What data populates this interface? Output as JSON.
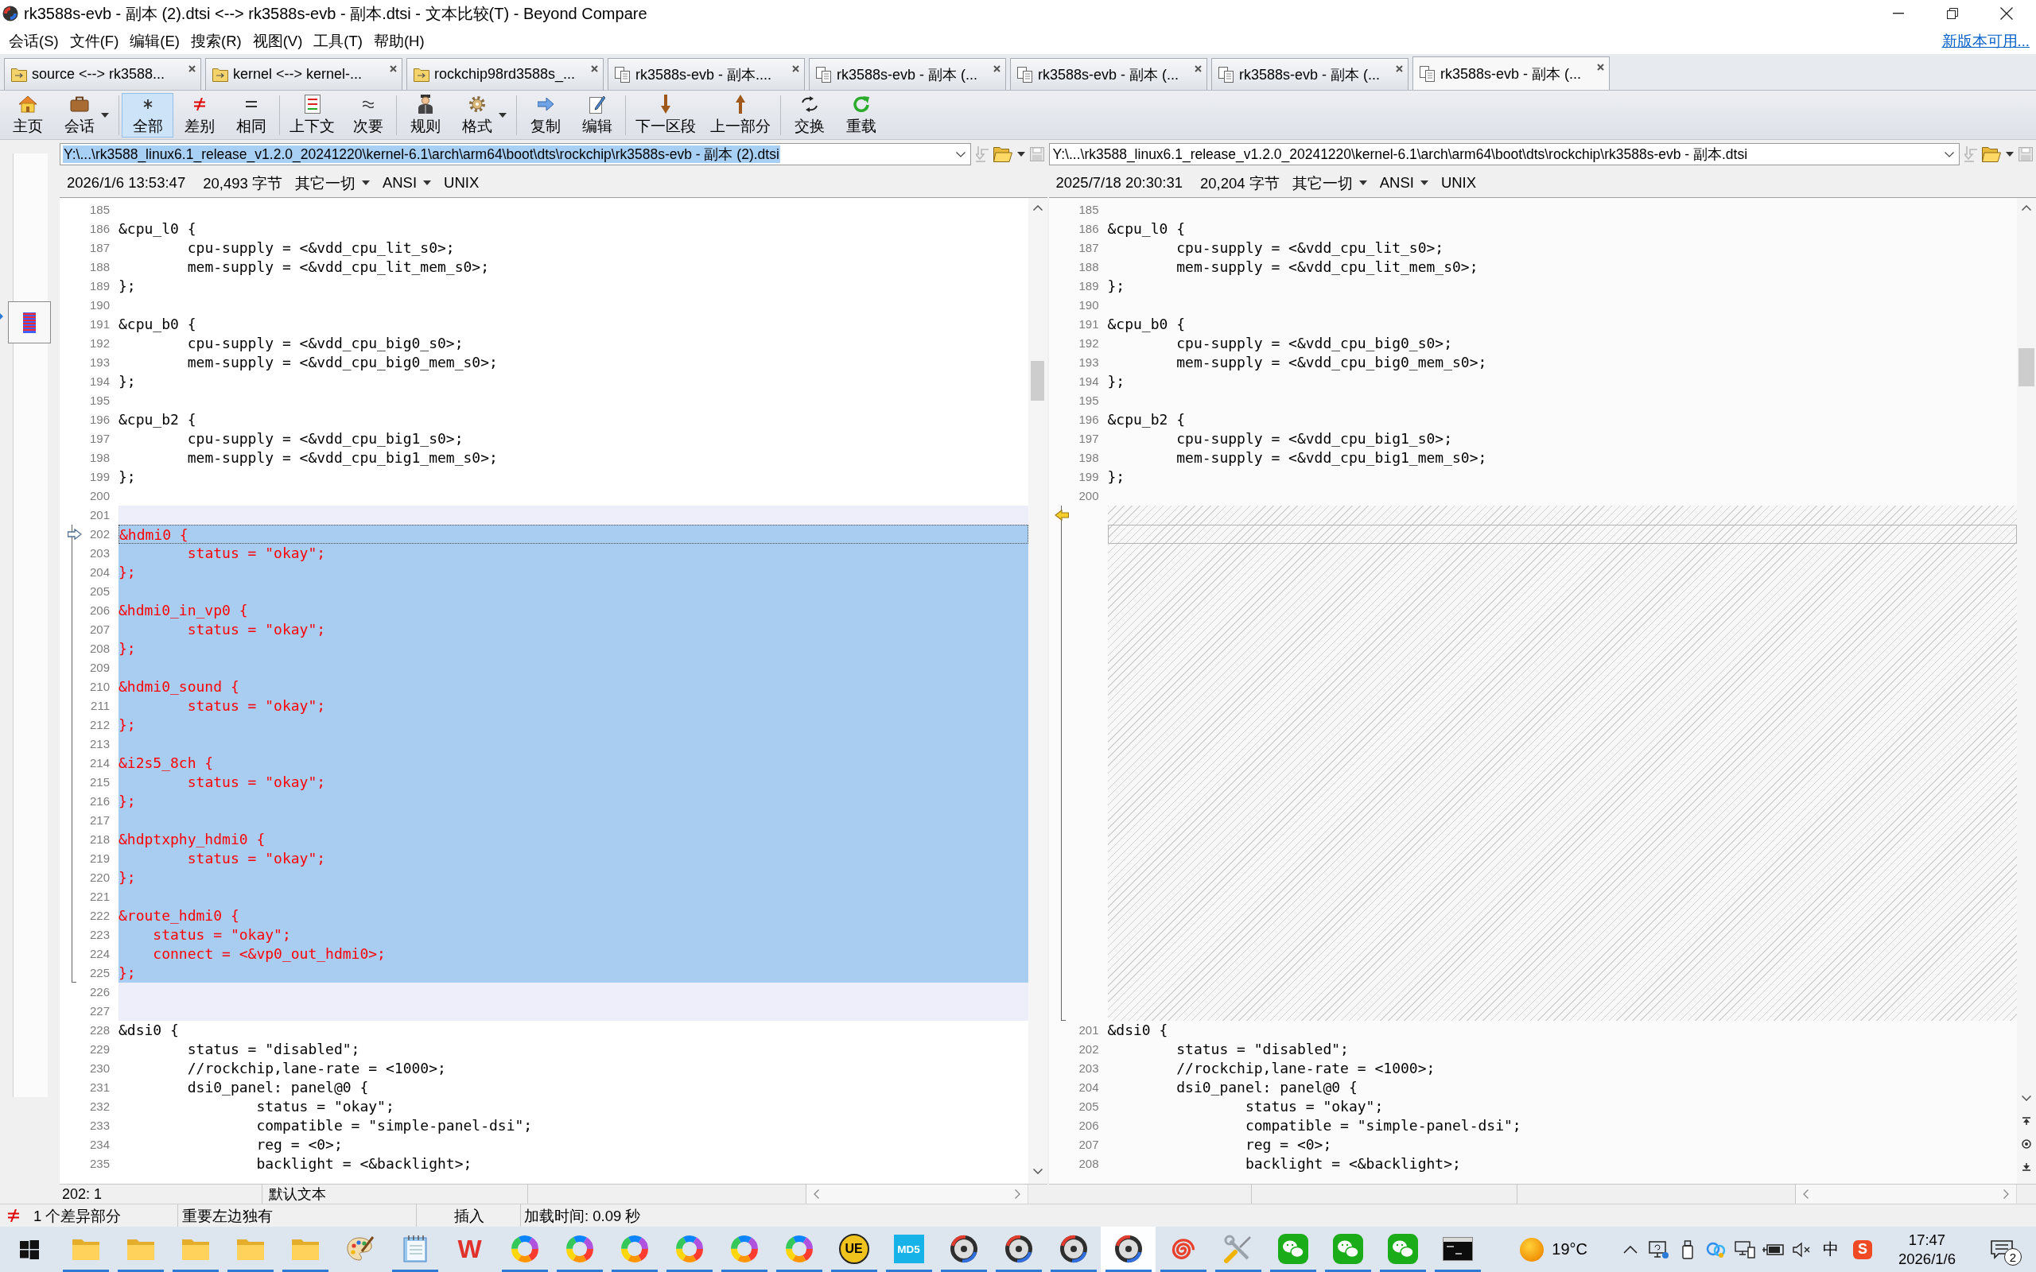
{
  "window": {
    "title": "rk3588s-evb - 副本 (2).dtsi <--> rk3588s-evb - 副本.dtsi - 文本比较(T) - Beyond Compare"
  },
  "menu": [
    "会话(S)",
    "文件(F)",
    "编辑(E)",
    "搜索(R)",
    "视图(V)",
    "工具(T)",
    "帮助(H)"
  ],
  "update_link": "新版本可用...",
  "tabs": [
    {
      "label": "source <--> rk3588...",
      "kind": "folder",
      "selected": false
    },
    {
      "label": "kernel <--> kernel-...",
      "kind": "folder",
      "selected": false
    },
    {
      "label": "rockchip98rd3588s_...",
      "kind": "folder",
      "selected": false
    },
    {
      "label": "rk3588s-evb - 副本....",
      "kind": "text",
      "selected": false
    },
    {
      "label": "rk3588s-evb - 副本 (...",
      "kind": "text",
      "selected": false
    },
    {
      "label": "rk3588s-evb - 副本 (...",
      "kind": "text",
      "selected": false
    },
    {
      "label": "rk3588s-evb - 副本 (...",
      "kind": "text",
      "selected": false
    },
    {
      "label": "rk3588s-evb - 副本 (...",
      "kind": "text",
      "selected": true
    }
  ],
  "toolbar": [
    [
      {
        "label": "主页",
        "kind": "home",
        "selected": false,
        "dropdown": false
      },
      {
        "label": "会话",
        "kind": "session",
        "selected": false,
        "dropdown": true
      }
    ],
    [
      {
        "label": "全部",
        "kind": "all",
        "selected": true,
        "dropdown": false
      },
      {
        "label": "差别",
        "kind": "diffs",
        "selected": false,
        "dropdown": false
      },
      {
        "label": "相同",
        "kind": "same",
        "selected": false,
        "dropdown": false
      }
    ],
    [
      {
        "label": "上下文",
        "kind": "context",
        "selected": false,
        "dropdown": false
      },
      {
        "label": "次要",
        "kind": "minor",
        "selected": false,
        "dropdown": false
      }
    ],
    [
      {
        "label": "规则",
        "kind": "rules",
        "selected": false,
        "dropdown": false
      },
      {
        "label": "格式",
        "kind": "format",
        "selected": false,
        "dropdown": true
      }
    ],
    [
      {
        "label": "复制",
        "kind": "copy",
        "selected": false,
        "dropdown": false
      },
      {
        "label": "编辑",
        "kind": "edit",
        "selected": false,
        "dropdown": false
      }
    ],
    [
      {
        "label": "下一区段",
        "kind": "next",
        "selected": false,
        "dropdown": false
      },
      {
        "label": "上一部分",
        "kind": "prev",
        "selected": false,
        "dropdown": false
      }
    ],
    [
      {
        "label": "交换",
        "kind": "swap",
        "selected": false,
        "dropdown": false
      },
      {
        "label": "重载",
        "kind": "reload",
        "selected": false,
        "dropdown": false
      }
    ]
  ],
  "panes": [
    {
      "path": "Y:\\...\\rk3588_linux6.1_release_v1.2.0_20241220\\kernel-6.1\\arch\\arm64\\boot\\dts\\rockchip\\rk3588s-evb - 副本 (2).dtsi",
      "path_selected": true,
      "modified": "2026/1/6 13:53:47",
      "size": "20,493 字节",
      "format": "其它一切",
      "encoding": "ANSI",
      "line_ending": "UNIX",
      "position": "202: 1",
      "text_format": "默认文本",
      "lines": [
        {
          "number": "185",
          "kind": "same",
          "current": false,
          "arrow": false
        },
        {
          "number": "186",
          "text": "&cpu_l0 {",
          "kind": "same",
          "current": false,
          "arrow": false
        },
        {
          "number": "187",
          "text": "\tcpu-supply = <&vdd_cpu_lit_s0>;",
          "kind": "same",
          "current": false,
          "arrow": false
        },
        {
          "number": "188",
          "text": "\tmem-supply = <&vdd_cpu_lit_mem_s0>;",
          "kind": "same",
          "current": false,
          "arrow": false
        },
        {
          "number": "189",
          "text": "};",
          "kind": "same",
          "current": false,
          "arrow": false
        },
        {
          "number": "190",
          "kind": "same",
          "current": false,
          "arrow": false
        },
        {
          "number": "191",
          "text": "&cpu_b0 {",
          "kind": "same",
          "current": false,
          "arrow": false
        },
        {
          "number": "192",
          "text": "\tcpu-supply = <&vdd_cpu_big0_s0>;",
          "kind": "same",
          "current": false,
          "arrow": false
        },
        {
          "number": "193",
          "text": "\tmem-supply = <&vdd_cpu_big0_mem_s0>;",
          "kind": "same",
          "current": false,
          "arrow": false
        },
        {
          "number": "194",
          "text": "};",
          "kind": "same",
          "current": false,
          "arrow": false
        },
        {
          "number": "195",
          "kind": "same",
          "current": false,
          "arrow": false
        },
        {
          "number": "196",
          "text": "&cpu_b2 {",
          "kind": "same",
          "current": false,
          "arrow": false
        },
        {
          "number": "197",
          "text": "\tcpu-supply = <&vdd_cpu_big1_s0>;",
          "kind": "same",
          "current": false,
          "arrow": false
        },
        {
          "number": "198",
          "text": "\tmem-supply = <&vdd_cpu_big1_mem_s0>;",
          "kind": "same",
          "current": false,
          "arrow": false
        },
        {
          "number": "199",
          "text": "};",
          "kind": "same",
          "current": false,
          "arrow": false
        },
        {
          "number": "200",
          "kind": "same",
          "current": false,
          "arrow": false
        },
        {
          "number": "201",
          "kind": "minor",
          "current": false,
          "arrow": false
        },
        {
          "number": "202",
          "text": "&hdmi0 {",
          "kind": "unique",
          "current": true,
          "arrow": true
        },
        {
          "number": "203",
          "text": "\tstatus = \"okay\";",
          "kind": "unique",
          "current": false,
          "arrow": false
        },
        {
          "number": "204",
          "text": "};",
          "kind": "unique",
          "current": false,
          "arrow": false
        },
        {
          "number": "205",
          "kind": "unique",
          "current": false,
          "arrow": false
        },
        {
          "number": "206",
          "text": "&hdmi0_in_vp0 {",
          "kind": "unique",
          "current": false,
          "arrow": false
        },
        {
          "number": "207",
          "text": "\tstatus = \"okay\";",
          "kind": "unique",
          "current": false,
          "arrow": false
        },
        {
          "number": "208",
          "text": "};",
          "kind": "unique",
          "current": false,
          "arrow": false
        },
        {
          "number": "209",
          "kind": "unique",
          "current": false,
          "arrow": false
        },
        {
          "number": "210",
          "text": "&hdmi0_sound {",
          "kind": "unique",
          "current": false,
          "arrow": false
        },
        {
          "number": "211",
          "text": "\tstatus = \"okay\";",
          "kind": "unique",
          "current": false,
          "arrow": false
        },
        {
          "number": "212",
          "text": "};",
          "kind": "unique",
          "current": false,
          "arrow": false
        },
        {
          "number": "213",
          "kind": "unique",
          "current": false,
          "arrow": false
        },
        {
          "number": "214",
          "text": "&i2s5_8ch {",
          "kind": "unique",
          "current": false,
          "arrow": false
        },
        {
          "number": "215",
          "text": "\tstatus = \"okay\";",
          "kind": "unique",
          "current": false,
          "arrow": false
        },
        {
          "number": "216",
          "text": "};",
          "kind": "unique",
          "current": false,
          "arrow": false
        },
        {
          "number": "217",
          "kind": "unique",
          "current": false,
          "arrow": false
        },
        {
          "number": "218",
          "text": "&hdptxphy_hdmi0 {",
          "kind": "unique",
          "current": false,
          "arrow": false
        },
        {
          "number": "219",
          "text": "\tstatus = \"okay\";",
          "kind": "unique",
          "current": false,
          "arrow": false
        },
        {
          "number": "220",
          "text": "};",
          "kind": "unique",
          "current": false,
          "arrow": false
        },
        {
          "number": "221",
          "kind": "unique",
          "current": false,
          "arrow": false
        },
        {
          "number": "222",
          "text": "&route_hdmi0 {",
          "kind": "unique",
          "current": false,
          "arrow": false
        },
        {
          "number": "223",
          "text": "    status = \"okay\";",
          "kind": "unique",
          "current": false,
          "arrow": false
        },
        {
          "number": "224",
          "text": "    connect = <&vp0_out_hdmi0>;",
          "kind": "unique",
          "current": false,
          "arrow": false
        },
        {
          "number": "225",
          "text": "};",
          "kind": "unique",
          "current": false,
          "arrow": false
        },
        {
          "number": "226",
          "kind": "minor",
          "current": false,
          "arrow": false
        },
        {
          "number": "227",
          "kind": "minor",
          "current": false,
          "arrow": false
        },
        {
          "number": "228",
          "text": "&dsi0 {",
          "kind": "same",
          "current": false,
          "arrow": false
        },
        {
          "number": "229",
          "text": "\tstatus = \"disabled\";",
          "kind": "same",
          "current": false,
          "arrow": false
        },
        {
          "number": "230",
          "text": "\t//rockchip,lane-rate = <1000>;",
          "kind": "same",
          "current": false,
          "arrow": false
        },
        {
          "number": "231",
          "text": "\tdsi0_panel: panel@0 {",
          "kind": "same",
          "current": false,
          "arrow": false
        },
        {
          "number": "232",
          "text": "\t\tstatus = \"okay\";",
          "kind": "same",
          "current": false,
          "arrow": false
        },
        {
          "number": "233",
          "text": "\t\tcompatible = \"simple-panel-dsi\";",
          "kind": "same",
          "current": false,
          "arrow": false
        },
        {
          "number": "234",
          "text": "\t\treg = <0>;",
          "kind": "same",
          "current": false,
          "arrow": false
        },
        {
          "number": "235",
          "text": "\t\tbacklight = <&backlight>;",
          "kind": "same",
          "current": false,
          "arrow": false
        }
      ]
    },
    {
      "path": "Y:\\...\\rk3588_linux6.1_release_v1.2.0_20241220\\kernel-6.1\\arch\\arm64\\boot\\dts\\rockchip\\rk3588s-evb - 副本.dtsi",
      "path_selected": false,
      "modified": "2025/7/18 20:30:31",
      "size": "20,204 字节",
      "format": "其它一切",
      "encoding": "ANSI",
      "line_ending": "UNIX",
      "lines": [
        {
          "number": "185",
          "kind": "same",
          "current": false,
          "arrow": false
        },
        {
          "number": "186",
          "text": "&cpu_l0 {",
          "kind": "same",
          "current": false,
          "arrow": false
        },
        {
          "number": "187",
          "text": "\tcpu-supply = <&vdd_cpu_lit_s0>;",
          "kind": "same",
          "current": false,
          "arrow": false
        },
        {
          "number": "188",
          "text": "\tmem-supply = <&vdd_cpu_lit_mem_s0>;",
          "kind": "same",
          "current": false,
          "arrow": false
        },
        {
          "number": "189",
          "text": "};",
          "kind": "same",
          "current": false,
          "arrow": false
        },
        {
          "number": "190",
          "kind": "same",
          "current": false,
          "arrow": false
        },
        {
          "number": "191",
          "text": "&cpu_b0 {",
          "kind": "same",
          "current": false,
          "arrow": false
        },
        {
          "number": "192",
          "text": "\tcpu-supply = <&vdd_cpu_big0_s0>;",
          "kind": "same",
          "current": false,
          "arrow": false
        },
        {
          "number": "193",
          "text": "\tmem-supply = <&vdd_cpu_big0_mem_s0>;",
          "kind": "same",
          "current": false,
          "arrow": false
        },
        {
          "number": "194",
          "text": "};",
          "kind": "same",
          "current": false,
          "arrow": false
        },
        {
          "number": "195",
          "kind": "same",
          "current": false,
          "arrow": false
        },
        {
          "number": "196",
          "text": "&cpu_b2 {",
          "kind": "same",
          "current": false,
          "arrow": false
        },
        {
          "number": "197",
          "text": "\tcpu-supply = <&vdd_cpu_big1_s0>;",
          "kind": "same",
          "current": false,
          "arrow": false
        },
        {
          "number": "198",
          "text": "\tmem-supply = <&vdd_cpu_big1_mem_s0>;",
          "kind": "same",
          "current": false,
          "arrow": false
        },
        {
          "number": "199",
          "text": "};",
          "kind": "same",
          "current": false,
          "arrow": false
        },
        {
          "number": "200",
          "kind": "same",
          "current": false,
          "arrow": false
        },
        {
          "kind": "gap",
          "current": false,
          "arrow": true
        },
        {
          "kind": "gap",
          "current": true,
          "arrow": false
        },
        {
          "kind": "gap",
          "current": false,
          "arrow": false
        },
        {
          "kind": "gap",
          "current": false,
          "arrow": false
        },
        {
          "kind": "gap",
          "current": false,
          "arrow": false
        },
        {
          "kind": "gap",
          "current": false,
          "arrow": false
        },
        {
          "kind": "gap",
          "current": false,
          "arrow": false
        },
        {
          "kind": "gap",
          "current": false,
          "arrow": false
        },
        {
          "kind": "gap",
          "current": false,
          "arrow": false
        },
        {
          "kind": "gap",
          "current": false,
          "arrow": false
        },
        {
          "kind": "gap",
          "current": false,
          "arrow": false
        },
        {
          "kind": "gap",
          "current": false,
          "arrow": false
        },
        {
          "kind": "gap",
          "current": false,
          "arrow": false
        },
        {
          "kind": "gap",
          "current": false,
          "arrow": false
        },
        {
          "kind": "gap",
          "current": false,
          "arrow": false
        },
        {
          "kind": "gap",
          "current": false,
          "arrow": false
        },
        {
          "kind": "gap",
          "current": false,
          "arrow": false
        },
        {
          "kind": "gap",
          "current": false,
          "arrow": false
        },
        {
          "kind": "gap",
          "current": false,
          "arrow": false
        },
        {
          "kind": "gap",
          "current": false,
          "arrow": false
        },
        {
          "kind": "gap",
          "current": false,
          "arrow": false
        },
        {
          "kind": "gap",
          "current": false,
          "arrow": false
        },
        {
          "kind": "gap",
          "current": false,
          "arrow": false
        },
        {
          "kind": "gap",
          "current": false,
          "arrow": false
        },
        {
          "kind": "gap",
          "current": false,
          "arrow": false
        },
        {
          "kind": "gap",
          "current": false,
          "arrow": false
        },
        {
          "kind": "gap",
          "current": false,
          "arrow": false
        },
        {
          "number": "201",
          "text": "&dsi0 {",
          "kind": "same",
          "current": false,
          "arrow": false
        },
        {
          "number": "202",
          "text": "\tstatus = \"disabled\";",
          "kind": "same",
          "current": false,
          "arrow": false
        },
        {
          "number": "203",
          "text": "\t//rockchip,lane-rate = <1000>;",
          "kind": "same",
          "current": false,
          "arrow": false
        },
        {
          "number": "204",
          "text": "\tdsi0_panel: panel@0 {",
          "kind": "same",
          "current": false,
          "arrow": false
        },
        {
          "number": "205",
          "text": "\t\tstatus = \"okay\";",
          "kind": "same",
          "current": false,
          "arrow": false
        },
        {
          "number": "206",
          "text": "\t\tcompatible = \"simple-panel-dsi\";",
          "kind": "same",
          "current": false,
          "arrow": false
        },
        {
          "number": "207",
          "text": "\t\treg = <0>;",
          "kind": "same",
          "current": false,
          "arrow": false
        },
        {
          "number": "208",
          "text": "\t\tbacklight = <&backlight>;",
          "kind": "same",
          "current": false,
          "arrow": false
        }
      ]
    }
  ],
  "status_bar": {
    "difference_count": "1 个差异部分",
    "summary": "重要左边独有",
    "mode": "插入",
    "load_time": "加载时间: 0.09 秒"
  },
  "taskbar": {
    "apps": [
      {
        "kind": "folder",
        "running": true,
        "selected": false
      },
      {
        "kind": "folder",
        "running": true,
        "selected": false
      },
      {
        "kind": "folder",
        "running": true,
        "selected": false
      },
      {
        "kind": "folder",
        "running": true,
        "selected": false
      },
      {
        "kind": "folder",
        "running": true,
        "selected": false
      },
      {
        "kind": "palette",
        "running": false,
        "selected": false
      },
      {
        "kind": "notepad",
        "running": true,
        "selected": false
      },
      {
        "kind": "letter",
        "text": "W",
        "running": false,
        "selected": false
      },
      {
        "kind": "ring",
        "running": true,
        "selected": false
      },
      {
        "kind": "ring",
        "running": true,
        "selected": false
      },
      {
        "kind": "ring",
        "running": true,
        "selected": false
      },
      {
        "kind": "ring",
        "running": true,
        "selected": false
      },
      {
        "kind": "ring",
        "running": true,
        "selected": false
      },
      {
        "kind": "ring",
        "running": true,
        "selected": false
      },
      {
        "kind": "badge",
        "text": "UE",
        "running": true,
        "selected": false
      },
      {
        "kind": "tile",
        "text": "MD5",
        "running": true,
        "selected": false
      },
      {
        "kind": "disc",
        "running": true,
        "selected": false
      },
      {
        "kind": "disc",
        "running": true,
        "selected": false
      },
      {
        "kind": "disc",
        "running": true,
        "selected": false
      },
      {
        "kind": "disc",
        "running": true,
        "selected": true
      },
      {
        "kind": "spiral",
        "running": true,
        "selected": false
      },
      {
        "kind": "tools",
        "running": true,
        "selected": false
      },
      {
        "kind": "chat",
        "running": true,
        "selected": false
      },
      {
        "kind": "chat",
        "running": true,
        "selected": false
      },
      {
        "kind": "chat",
        "running": true,
        "selected": false
      },
      {
        "kind": "terminal",
        "running": true,
        "selected": false
      }
    ],
    "temperature": "19°C",
    "tray": [
      {
        "kind": "chevron"
      },
      {
        "kind": "display"
      },
      {
        "kind": "usb"
      },
      {
        "kind": "cloud"
      },
      {
        "kind": "network"
      },
      {
        "kind": "battery"
      },
      {
        "kind": "muted"
      }
    ],
    "input_mode": "中",
    "input_logo": "S",
    "time": "17:47",
    "date": "2026/1/6",
    "notifications": "2"
  }
}
